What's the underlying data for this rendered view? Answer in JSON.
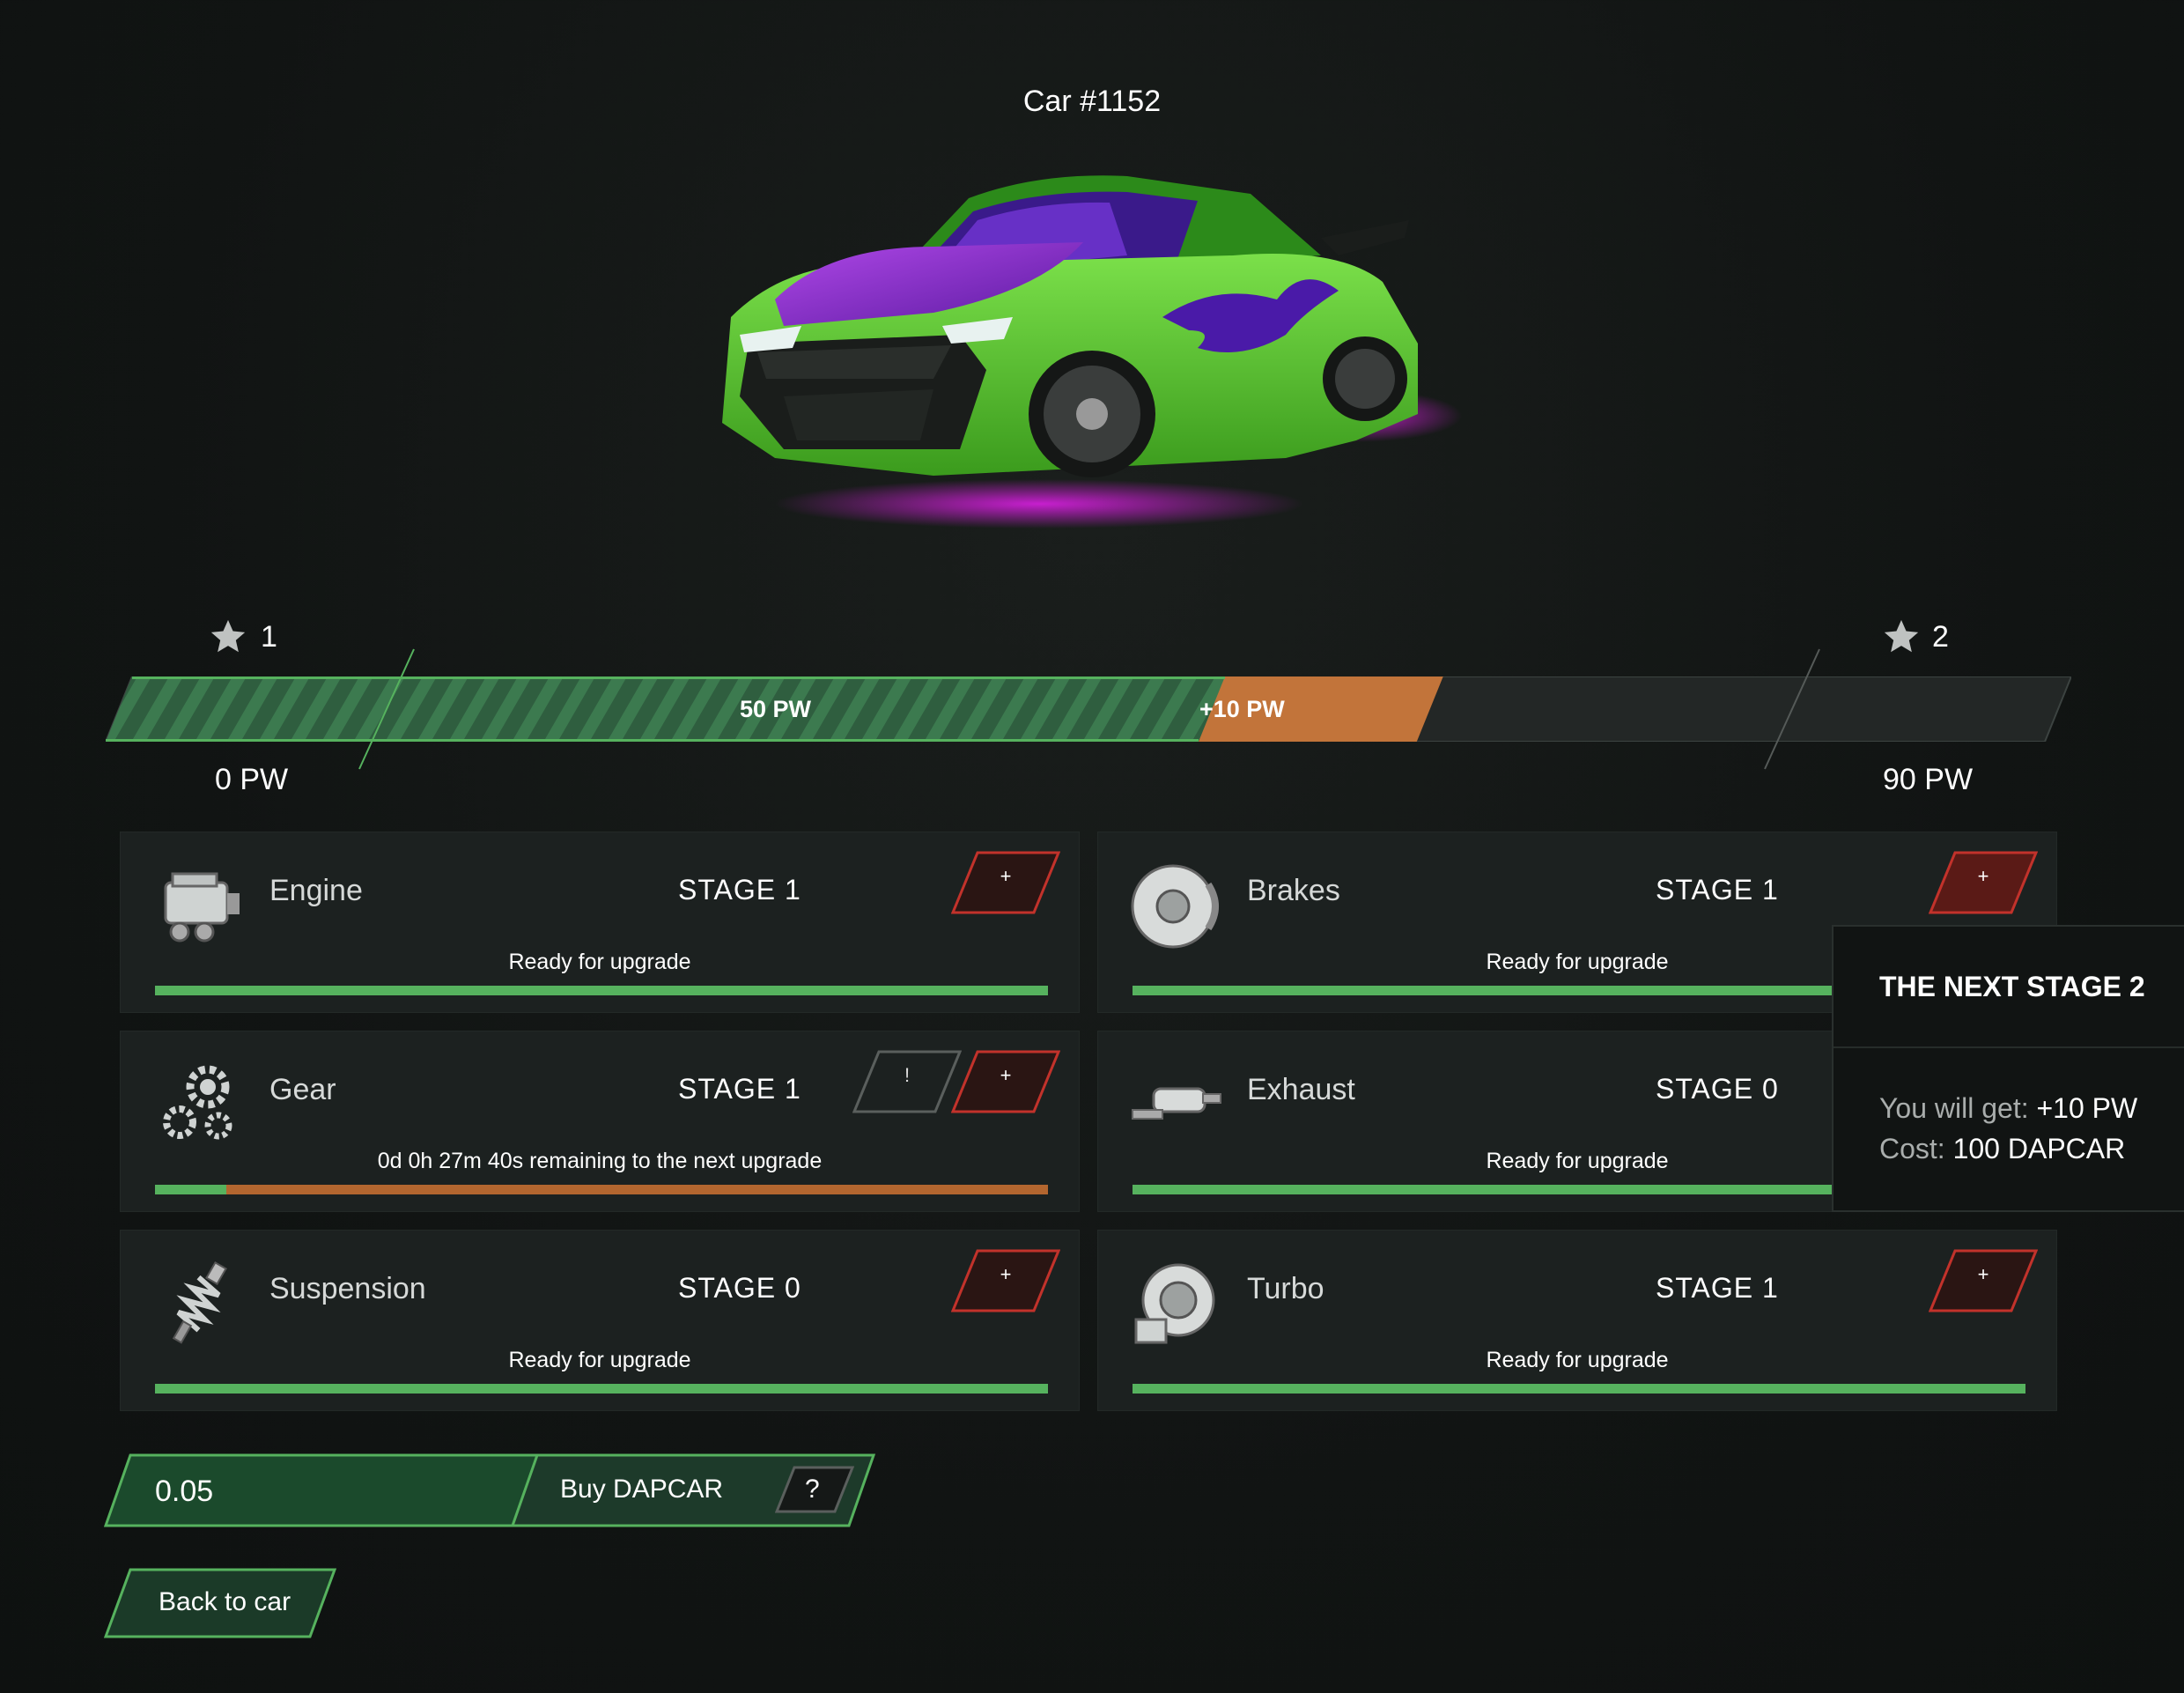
{
  "page": {
    "title": "Car #1152"
  },
  "progress": {
    "start_level": "1",
    "end_level": "2",
    "current_label": "50 PW",
    "bonus_label": "+10 PW",
    "min_label": "0 PW",
    "max_label": "90 PW",
    "current_fraction": 0.556,
    "bonus_fraction": 0.111
  },
  "parts": [
    {
      "name": "Engine",
      "stage": "STAGE 1",
      "status": "Ready for upgrade",
      "plus_label": "+",
      "icon": "engine-icon",
      "progress": 1.0
    },
    {
      "name": "Brakes",
      "stage": "STAGE 1",
      "status": "Ready for upgrade",
      "plus_label": "+",
      "icon": "brake-disc-icon",
      "progress": 1.0
    },
    {
      "name": "Gear",
      "stage": "STAGE 1",
      "status": "0d 0h 27m 40s remaining to the next upgrade",
      "plus_label": "+",
      "warn_label": "!",
      "icon": "gears-icon",
      "progress": 0.08
    },
    {
      "name": "Exhaust",
      "stage": "STAGE 0",
      "status": "Ready for upgrade",
      "plus_label": "+",
      "icon": "exhaust-icon",
      "progress": 1.0
    },
    {
      "name": "Suspension",
      "stage": "STAGE 0",
      "status": "Ready for upgrade",
      "plus_label": "+",
      "icon": "suspension-icon",
      "progress": 1.0
    },
    {
      "name": "Turbo",
      "stage": "STAGE 1",
      "status": "Ready for upgrade",
      "plus_label": "+",
      "icon": "turbo-icon",
      "progress": 1.0
    }
  ],
  "tooltip": {
    "heading": "THE NEXT STAGE 2",
    "get_label": "You will get:",
    "get_value": "+10 PW",
    "cost_label": "Cost:",
    "cost_value": "100 DAPCAR"
  },
  "buy": {
    "amount_value": "0.05",
    "button_label": "Buy DAPCAR",
    "help_label": "?"
  },
  "back_label": "Back to car",
  "colors": {
    "accent_green": "#56b25e",
    "bar_green": "#2f5a3d",
    "bonus_orange": "#b3662f",
    "danger_red": "#c2322b",
    "background": "#121514"
  }
}
